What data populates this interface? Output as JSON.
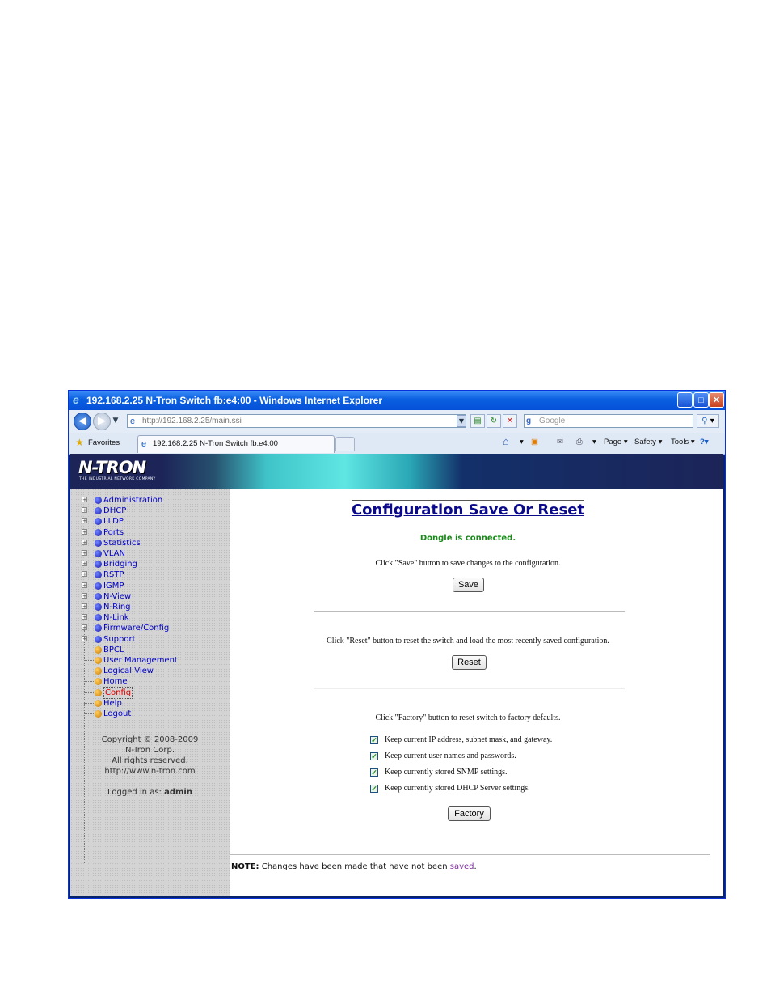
{
  "window": {
    "title": "192.168.2.25 N-Tron Switch fb:e4:00 - Windows Internet Explorer",
    "controls": {
      "minimize": "_",
      "maximize": "□",
      "close": "✕"
    }
  },
  "navbar": {
    "address": "http://192.168.2.25/main.ssi",
    "search_placeholder": "Google",
    "icons": [
      "back-icon",
      "forward-icon",
      "compatibility-icon",
      "refresh-icon",
      "stop-icon",
      "search-icon"
    ]
  },
  "favbar": {
    "favorites_label": "Favorites",
    "tab_label": "192.168.2.25 N-Tron Switch fb:e4:00",
    "commands": {
      "page": "Page ▾",
      "safety": "Safety ▾",
      "tools": "Tools ▾"
    }
  },
  "banner": {
    "logo": "N-TRON",
    "logo_tagline": "THE INDUSTRIAL NETWORK COMPANY"
  },
  "sidebar": {
    "items": [
      {
        "label": "Administration",
        "expandable": true,
        "dot": "blue"
      },
      {
        "label": "DHCP",
        "expandable": true,
        "dot": "blue"
      },
      {
        "label": "LLDP",
        "expandable": true,
        "dot": "blue"
      },
      {
        "label": "Ports",
        "expandable": true,
        "dot": "blue"
      },
      {
        "label": "Statistics",
        "expandable": true,
        "dot": "blue"
      },
      {
        "label": "VLAN",
        "expandable": true,
        "dot": "blue"
      },
      {
        "label": "Bridging",
        "expandable": true,
        "dot": "blue"
      },
      {
        "label": "RSTP",
        "expandable": true,
        "dot": "blue"
      },
      {
        "label": "IGMP",
        "expandable": true,
        "dot": "blue"
      },
      {
        "label": "N-View",
        "expandable": true,
        "dot": "blue"
      },
      {
        "label": "N-Ring",
        "expandable": true,
        "dot": "blue"
      },
      {
        "label": "N-Link",
        "expandable": true,
        "dot": "blue"
      },
      {
        "label": "Firmware/Config",
        "expandable": true,
        "dot": "blue"
      },
      {
        "label": "Support",
        "expandable": true,
        "dot": "blue"
      },
      {
        "label": "BPCL",
        "expandable": false,
        "dot": "orange"
      },
      {
        "label": "User Management",
        "expandable": false,
        "dot": "orange"
      },
      {
        "label": "Logical View",
        "expandable": false,
        "dot": "orange"
      },
      {
        "label": "Home",
        "expandable": false,
        "dot": "orange"
      },
      {
        "label": "Config",
        "expandable": false,
        "dot": "orange",
        "active": true
      },
      {
        "label": "Help",
        "expandable": false,
        "dot": "orange"
      },
      {
        "label": "Logout",
        "expandable": false,
        "dot": "orange"
      }
    ],
    "copyright": [
      "Copyright © 2008-2009",
      "N-Tron Corp.",
      "All rights reserved.",
      "http://www.n-tron.com"
    ],
    "logged_in_prefix": "Logged in as: ",
    "logged_in_user": "admin"
  },
  "main": {
    "title": "Configuration Save Or Reset",
    "status": "Dongle is connected.",
    "save_instruction": "Click \"Save\" button to save changes to the configuration.",
    "save_button": "Save",
    "reset_instruction": "Click \"Reset\" button to reset the switch and load the most recently saved configuration.",
    "reset_button": "Reset",
    "factory_instruction": "Click \"Factory\" button to reset switch to factory defaults.",
    "factory_options": [
      {
        "label": "Keep current IP address, subnet mask, and gateway.",
        "checked": true
      },
      {
        "label": "Keep current user names and passwords.",
        "checked": true
      },
      {
        "label": "Keep currently stored SNMP settings.",
        "checked": true
      },
      {
        "label": "Keep currently stored DHCP Server settings.",
        "checked": true
      }
    ],
    "factory_button": "Factory",
    "note_label": "NOTE:",
    "note_text": " Changes have been made that have not been ",
    "note_link": "saved",
    "note_end": "."
  }
}
